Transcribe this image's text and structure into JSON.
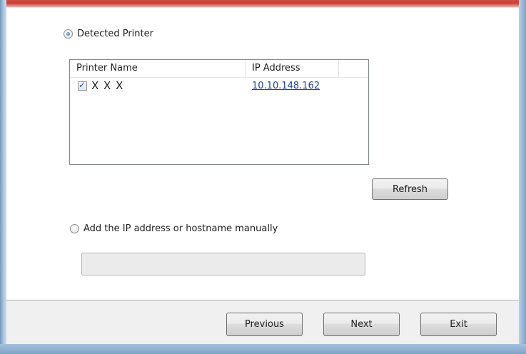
{
  "detected_option": {
    "label": "Detected Printer",
    "selected": true
  },
  "printer_list": {
    "columns": [
      "Printer Name",
      "IP Address",
      ""
    ],
    "rows": [
      {
        "name": "X X X",
        "checked": true,
        "ip": "10.10.148.162"
      }
    ]
  },
  "refresh_button": {
    "label": "Refresh"
  },
  "manual_option": {
    "label": "Add the IP address or hostname manually",
    "selected": false
  },
  "manual_input": {
    "value": "",
    "enabled": false
  },
  "footer": {
    "previous_label": "Previous",
    "next_label": "Next",
    "exit_label": "Exit"
  },
  "colors": {
    "accent_line": "#c93d36",
    "link": "#1a3fa8",
    "frame": "#7fa3c7"
  }
}
